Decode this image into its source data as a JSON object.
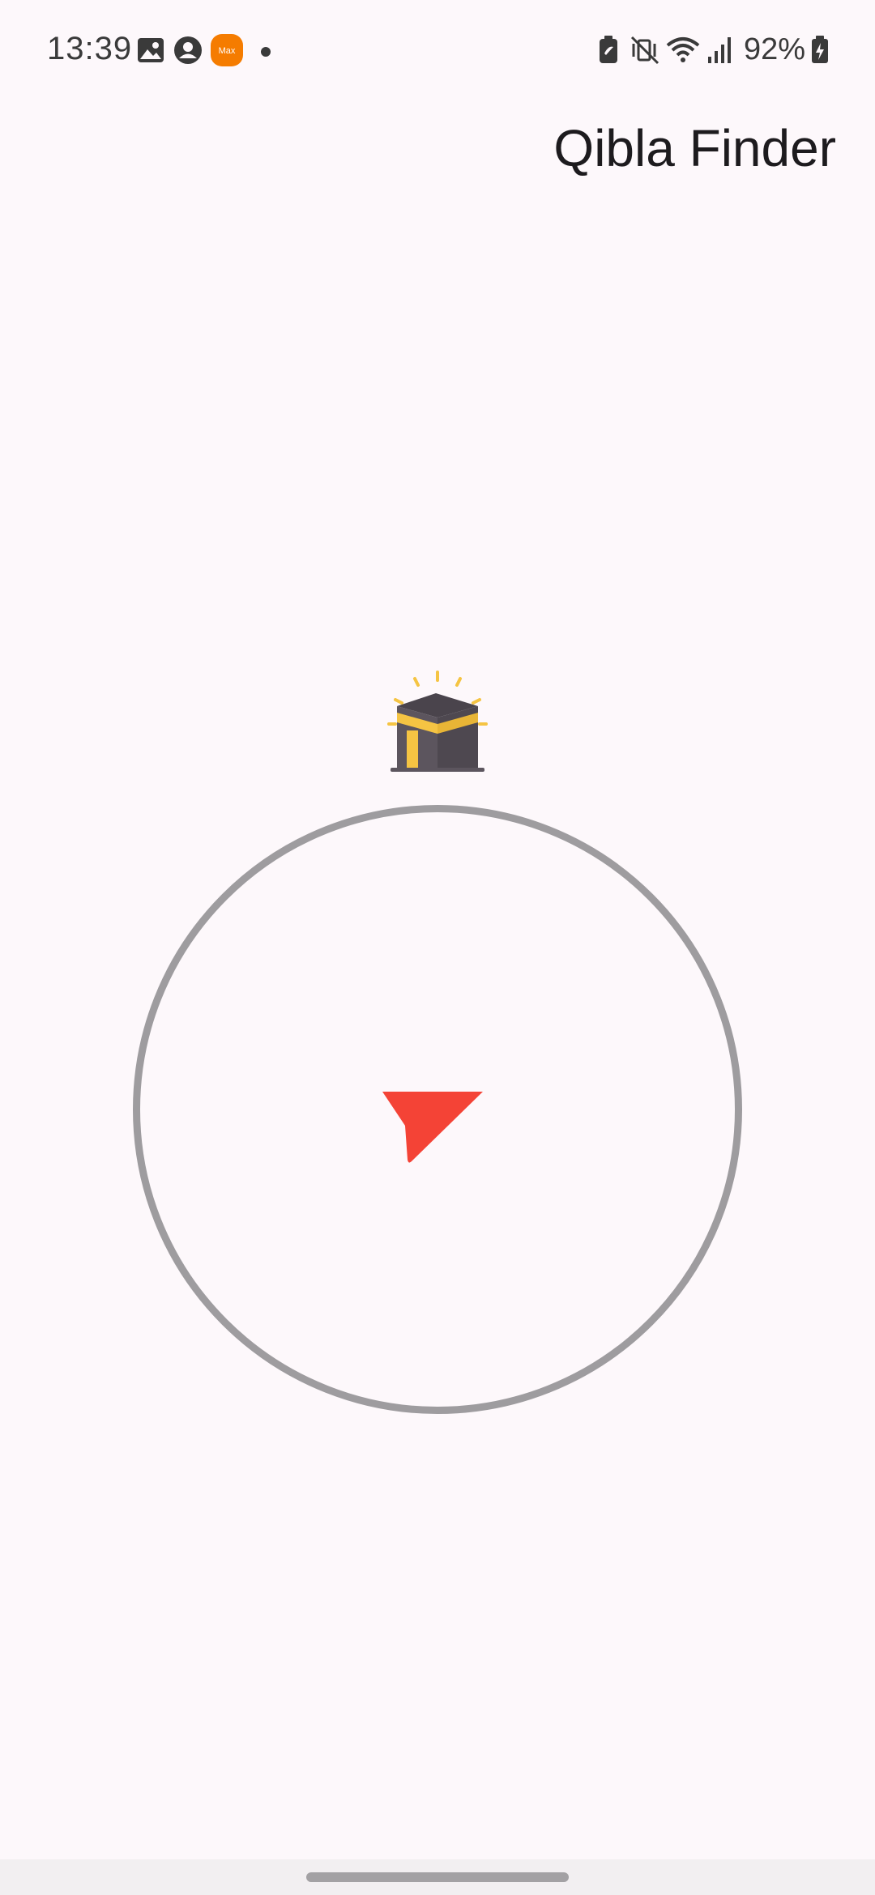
{
  "status_bar": {
    "time": "13:39",
    "battery_percent": "92%",
    "left_icons": [
      "gallery-icon",
      "account-icon",
      "maxit-app-icon",
      "notification-dot-icon"
    ],
    "right_icons": [
      "battery-saver-icon",
      "vibrate-mute-icon",
      "wifi-icon",
      "signal-icon",
      "battery-charging-icon"
    ]
  },
  "header": {
    "title": "Qibla Finder"
  },
  "compass": {
    "target_icon": "kaaba-icon",
    "pointer_icon": "direction-arrow-icon",
    "ring_color": "#9E9C9F",
    "pointer_color": "#F44336"
  },
  "colors": {
    "background": "#FDF8FB",
    "kaaba_body": "#59525A",
    "kaaba_band": "#F5C443"
  }
}
